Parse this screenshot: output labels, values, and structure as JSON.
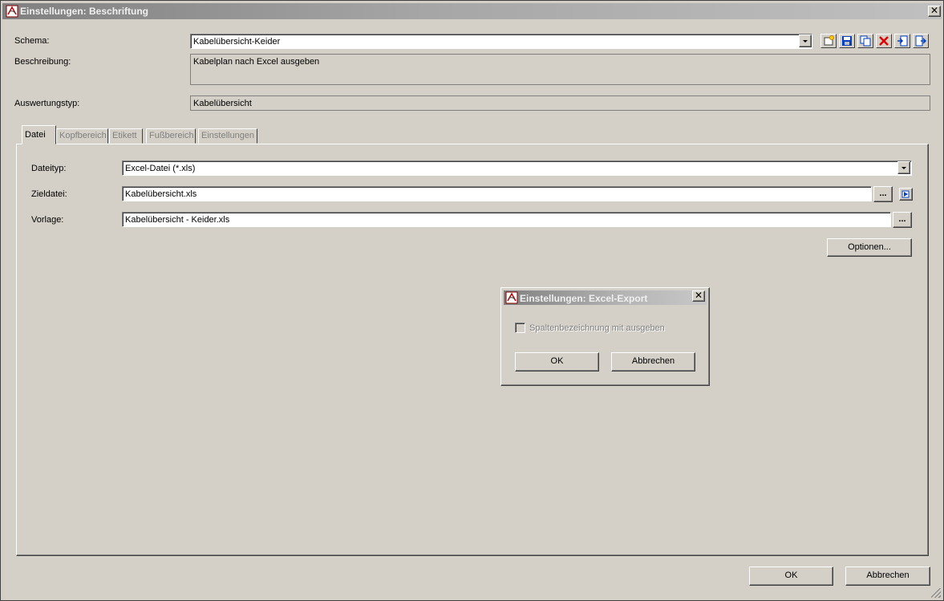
{
  "window": {
    "title": "Einstellungen: Beschriftung",
    "close_glyph": "✕"
  },
  "form": {
    "schema_label": "Schema:",
    "schema_value": "Kabelübersicht-Keider",
    "beschreibung_label": "Beschreibung:",
    "beschreibung_value": "Kabelplan nach Excel ausgeben",
    "auswertungstyp_label": "Auswertungstyp:",
    "auswertungstyp_value": "Kabelübersicht"
  },
  "toolbar": {
    "icons": [
      "new-icon",
      "save-icon",
      "copy-icon",
      "delete-icon",
      "import-icon",
      "export-icon"
    ]
  },
  "tabs": [
    {
      "label": "Datei",
      "active": true
    },
    {
      "label": "Kopfbereich",
      "active": false
    },
    {
      "label": "Etikett",
      "active": false
    },
    {
      "label": "Fußbereich",
      "active": false
    },
    {
      "label": "Einstellungen",
      "active": false
    }
  ],
  "datei": {
    "dateityp_label": "Dateityp:",
    "dateityp_value": "Excel-Datei (*.xls)",
    "zieldatei_label": "Zieldatei:",
    "zieldatei_value": "Kabelübersicht.xls",
    "vorlage_label": "Vorlage:",
    "vorlage_value": "Kabelübersicht - Keider.xls",
    "browse_label": "...",
    "optionen_label": "Optionen..."
  },
  "dialog": {
    "title": "Einstellungen: Excel-Export",
    "checkbox_label": "Spaltenbezeichnung mit ausgeben",
    "checkbox_checked": false,
    "ok_label": "OK",
    "cancel_label": "Abbrechen"
  },
  "footer": {
    "ok_label": "OK",
    "cancel_label": "Abbrechen"
  },
  "colors": {
    "face": "#d4d0c8",
    "title_gradient_start": "#808080",
    "delete_red": "#e00000",
    "icon_blue": "#0040c0"
  }
}
